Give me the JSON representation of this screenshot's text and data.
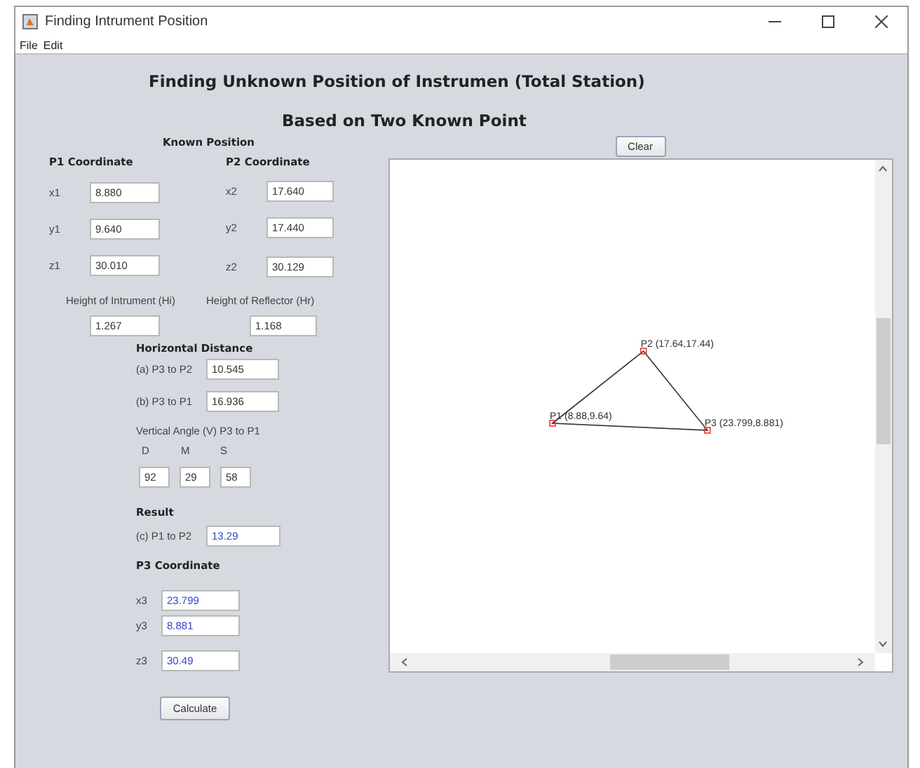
{
  "window": {
    "title": "Finding Intrument Position"
  },
  "menu": [
    "File",
    "Edit"
  ],
  "heading": "Finding Unknown Position of Instrumen (Total Station)",
  "subheading": "Based on Two Known Point",
  "known_position": "Known Position",
  "p1": {
    "title": "P1 Coordinate",
    "fields": [
      {
        "label": "x1",
        "value": "8.880"
      },
      {
        "label": "y1",
        "value": "9.640"
      },
      {
        "label": "z1",
        "value": "30.010"
      }
    ]
  },
  "p2": {
    "title": "P2 Coordinate",
    "fields": [
      {
        "label": "x2",
        "value": "17.640"
      },
      {
        "label": "y2",
        "value": "17.440"
      },
      {
        "label": "z2",
        "value": "30.129"
      }
    ]
  },
  "heights": [
    {
      "label": "Height of Intrument (Hi)",
      "value": "1.267"
    },
    {
      "label": "Height of Reflector (Hr)",
      "value": "1.168"
    }
  ],
  "horizontal": {
    "title": "Horizontal Distance",
    "fields": [
      {
        "label": "(a) P3 to P2",
        "value": "10.545"
      },
      {
        "label": "(b) P3 to P1",
        "value": "16.936"
      }
    ]
  },
  "vertical": {
    "title": "Vertical Angle (V) P3 to P1",
    "fields": [
      {
        "label": "D",
        "value": "92"
      },
      {
        "label": "M",
        "value": "29"
      },
      {
        "label": "S",
        "value": "58"
      }
    ]
  },
  "result": {
    "title": "Result",
    "label": "(c) P1 to P2",
    "value": "13.29"
  },
  "p3": {
    "title": "P3 Coordinate",
    "fields": [
      {
        "label": "x3",
        "value": "23.799"
      },
      {
        "label": "y3",
        "value": "8.881"
      },
      {
        "label": "z3",
        "value": "30.49"
      }
    ]
  },
  "calculate": "Calculate",
  "clear": "Clear",
  "diagram": {
    "labels": [
      "P1 (8.88,9.64)",
      "P2 (17.64,17.44)",
      "P3 (23.799,8.881)"
    ]
  }
}
